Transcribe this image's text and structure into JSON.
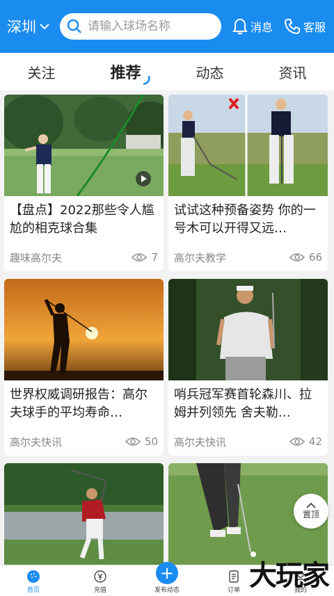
{
  "header": {
    "city": "深圳",
    "search_placeholder": "请输入球场名称",
    "messages_label": "消息",
    "service_label": "客服"
  },
  "tabs": [
    {
      "label": "关注"
    },
    {
      "label": "推荐"
    },
    {
      "label": "动态"
    },
    {
      "label": "资讯"
    }
  ],
  "cards": [
    {
      "title": "【盘点】2022那些令人尴尬的相克球合集",
      "source": "趣味高尔夫",
      "views": "7"
    },
    {
      "title": "试试这种预备姿势 你的一号木可以开得又远…",
      "source": "高尔夫教学",
      "views": "66"
    },
    {
      "title": "世界权威调研报告：高尔夫球手的平均寿命…",
      "source": "高尔夫快讯",
      "views": "50"
    },
    {
      "title": "哨兵冠军赛首轮森川、拉姆并列领先 舍夫勒…",
      "source": "高尔夫快讯",
      "views": "42"
    }
  ],
  "back_to_top": "置顶",
  "bottom_nav": [
    {
      "label": "首页"
    },
    {
      "label": "充值"
    },
    {
      "label": "发布动态"
    },
    {
      "label": "订单"
    },
    {
      "label": "我的"
    }
  ],
  "watermark": "大玩家",
  "colors": {
    "brand": "#1a8cf0",
    "text": "#222222",
    "muted": "#888888"
  }
}
